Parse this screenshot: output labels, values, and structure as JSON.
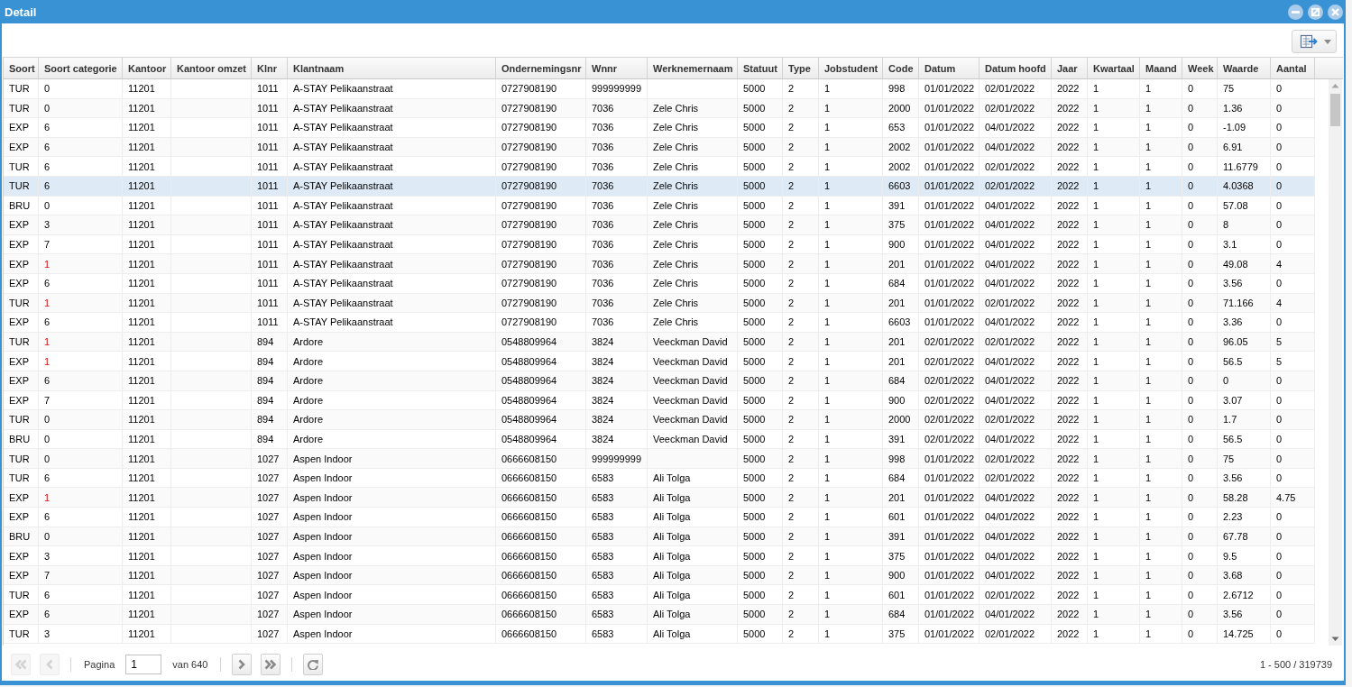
{
  "window": {
    "title": "Detail"
  },
  "table": {
    "columns": [
      "Soort",
      "Soort categorie",
      "Kantoor",
      "Kantoor omzet",
      "Klnr",
      "Klantnaam",
      "Ondernemingsnr",
      "Wnnr",
      "Werknemernaam",
      "Statuut",
      "Type",
      "Jobstudent",
      "Code",
      "Datum",
      "Datum hoofd",
      "Jaar",
      "Kwartaal",
      "Maand",
      "Week",
      "Waarde",
      "Aantal"
    ],
    "rows": [
      {
        "cells": [
          "TUR",
          "0",
          "11201",
          null,
          "1011",
          "A-STAY Pelikaanstraat",
          "0727908190",
          "999999999",
          null,
          "5000",
          "2",
          "1",
          "998",
          "01/01/2022",
          "02/01/2022",
          "2022",
          "1",
          "1",
          "0",
          "75",
          "0"
        ],
        "selected": false,
        "category_flagged": false
      },
      {
        "cells": [
          "TUR",
          "0",
          "11201",
          null,
          "1011",
          "A-STAY Pelikaanstraat",
          "0727908190",
          "7036",
          "Zele Chris",
          "5000",
          "2",
          "1",
          "2000",
          "01/01/2022",
          "02/01/2022",
          "2022",
          "1",
          "1",
          "0",
          "1.36",
          "0"
        ],
        "selected": false,
        "category_flagged": false
      },
      {
        "cells": [
          "EXP",
          "6",
          "11201",
          null,
          "1011",
          "A-STAY Pelikaanstraat",
          "0727908190",
          "7036",
          "Zele Chris",
          "5000",
          "2",
          "1",
          "653",
          "01/01/2022",
          "04/01/2022",
          "2022",
          "1",
          "1",
          "0",
          "-1.09",
          "0"
        ],
        "selected": false,
        "category_flagged": false
      },
      {
        "cells": [
          "EXP",
          "6",
          "11201",
          null,
          "1011",
          "A-STAY Pelikaanstraat",
          "0727908190",
          "7036",
          "Zele Chris",
          "5000",
          "2",
          "1",
          "2002",
          "01/01/2022",
          "04/01/2022",
          "2022",
          "1",
          "1",
          "0",
          "6.91",
          "0"
        ],
        "selected": false,
        "category_flagged": false
      },
      {
        "cells": [
          "TUR",
          "6",
          "11201",
          null,
          "1011",
          "A-STAY Pelikaanstraat",
          "0727908190",
          "7036",
          "Zele Chris",
          "5000",
          "2",
          "1",
          "2002",
          "01/01/2022",
          "02/01/2022",
          "2022",
          "1",
          "1",
          "0",
          "11.6779",
          "0"
        ],
        "selected": false,
        "category_flagged": false
      },
      {
        "cells": [
          "TUR",
          "6",
          "11201",
          null,
          "1011",
          "A-STAY Pelikaanstraat",
          "0727908190",
          "7036",
          "Zele Chris",
          "5000",
          "2",
          "1",
          "6603",
          "01/01/2022",
          "02/01/2022",
          "2022",
          "1",
          "1",
          "0",
          "4.0368",
          "0"
        ],
        "selected": true,
        "category_flagged": false
      },
      {
        "cells": [
          "BRU",
          "0",
          "11201",
          null,
          "1011",
          "A-STAY Pelikaanstraat",
          "0727908190",
          "7036",
          "Zele Chris",
          "5000",
          "2",
          "1",
          "391",
          "01/01/2022",
          "04/01/2022",
          "2022",
          "1",
          "1",
          "0",
          "57.08",
          "0"
        ],
        "selected": false,
        "category_flagged": false
      },
      {
        "cells": [
          "EXP",
          "3",
          "11201",
          null,
          "1011",
          "A-STAY Pelikaanstraat",
          "0727908190",
          "7036",
          "Zele Chris",
          "5000",
          "2",
          "1",
          "375",
          "01/01/2022",
          "04/01/2022",
          "2022",
          "1",
          "1",
          "0",
          "8",
          "0"
        ],
        "selected": false,
        "category_flagged": false
      },
      {
        "cells": [
          "EXP",
          "7",
          "11201",
          null,
          "1011",
          "A-STAY Pelikaanstraat",
          "0727908190",
          "7036",
          "Zele Chris",
          "5000",
          "2",
          "1",
          "900",
          "01/01/2022",
          "04/01/2022",
          "2022",
          "1",
          "1",
          "0",
          "3.1",
          "0"
        ],
        "selected": false,
        "category_flagged": false
      },
      {
        "cells": [
          "EXP",
          "1",
          "11201",
          null,
          "1011",
          "A-STAY Pelikaanstraat",
          "0727908190",
          "7036",
          "Zele Chris",
          "5000",
          "2",
          "1",
          "201",
          "01/01/2022",
          "04/01/2022",
          "2022",
          "1",
          "1",
          "0",
          "49.08",
          "4"
        ],
        "selected": false,
        "category_flagged": true
      },
      {
        "cells": [
          "EXP",
          "6",
          "11201",
          null,
          "1011",
          "A-STAY Pelikaanstraat",
          "0727908190",
          "7036",
          "Zele Chris",
          "5000",
          "2",
          "1",
          "684",
          "01/01/2022",
          "04/01/2022",
          "2022",
          "1",
          "1",
          "0",
          "3.56",
          "0"
        ],
        "selected": false,
        "category_flagged": false
      },
      {
        "cells": [
          "TUR",
          "1",
          "11201",
          null,
          "1011",
          "A-STAY Pelikaanstraat",
          "0727908190",
          "7036",
          "Zele Chris",
          "5000",
          "2",
          "1",
          "201",
          "01/01/2022",
          "02/01/2022",
          "2022",
          "1",
          "1",
          "0",
          "71.166",
          "4"
        ],
        "selected": false,
        "category_flagged": true
      },
      {
        "cells": [
          "EXP",
          "6",
          "11201",
          null,
          "1011",
          "A-STAY Pelikaanstraat",
          "0727908190",
          "7036",
          "Zele Chris",
          "5000",
          "2",
          "1",
          "6603",
          "01/01/2022",
          "04/01/2022",
          "2022",
          "1",
          "1",
          "0",
          "3.36",
          "0"
        ],
        "selected": false,
        "category_flagged": false
      },
      {
        "cells": [
          "TUR",
          "1",
          "11201",
          null,
          "894",
          "Ardore",
          "0548809964",
          "3824",
          "Veeckman David",
          "5000",
          "2",
          "1",
          "201",
          "02/01/2022",
          "02/01/2022",
          "2022",
          "1",
          "1",
          "0",
          "96.05",
          "5"
        ],
        "selected": false,
        "category_flagged": true
      },
      {
        "cells": [
          "EXP",
          "1",
          "11201",
          null,
          "894",
          "Ardore",
          "0548809964",
          "3824",
          "Veeckman David",
          "5000",
          "2",
          "1",
          "201",
          "02/01/2022",
          "04/01/2022",
          "2022",
          "1",
          "1",
          "0",
          "56.5",
          "5"
        ],
        "selected": false,
        "category_flagged": true
      },
      {
        "cells": [
          "EXP",
          "6",
          "11201",
          null,
          "894",
          "Ardore",
          "0548809964",
          "3824",
          "Veeckman David",
          "5000",
          "2",
          "1",
          "684",
          "02/01/2022",
          "04/01/2022",
          "2022",
          "1",
          "1",
          "0",
          "0",
          "0"
        ],
        "selected": false,
        "category_flagged": false
      },
      {
        "cells": [
          "EXP",
          "7",
          "11201",
          null,
          "894",
          "Ardore",
          "0548809964",
          "3824",
          "Veeckman David",
          "5000",
          "2",
          "1",
          "900",
          "02/01/2022",
          "04/01/2022",
          "2022",
          "1",
          "1",
          "0",
          "3.07",
          "0"
        ],
        "selected": false,
        "category_flagged": false
      },
      {
        "cells": [
          "TUR",
          "0",
          "11201",
          null,
          "894",
          "Ardore",
          "0548809964",
          "3824",
          "Veeckman David",
          "5000",
          "2",
          "1",
          "2000",
          "02/01/2022",
          "02/01/2022",
          "2022",
          "1",
          "1",
          "0",
          "1.7",
          "0"
        ],
        "selected": false,
        "category_flagged": false
      },
      {
        "cells": [
          "BRU",
          "0",
          "11201",
          null,
          "894",
          "Ardore",
          "0548809964",
          "3824",
          "Veeckman David",
          "5000",
          "2",
          "1",
          "391",
          "02/01/2022",
          "04/01/2022",
          "2022",
          "1",
          "1",
          "0",
          "56.5",
          "0"
        ],
        "selected": false,
        "category_flagged": false
      },
      {
        "cells": [
          "TUR",
          "0",
          "11201",
          null,
          "1027",
          "Aspen Indoor",
          "0666608150",
          "999999999",
          null,
          "5000",
          "2",
          "1",
          "998",
          "01/01/2022",
          "02/01/2022",
          "2022",
          "1",
          "1",
          "0",
          "75",
          "0"
        ],
        "selected": false,
        "category_flagged": false
      },
      {
        "cells": [
          "TUR",
          "6",
          "11201",
          null,
          "1027",
          "Aspen Indoor",
          "0666608150",
          "6583",
          "Ali Tolga",
          "5000",
          "2",
          "1",
          "684",
          "01/01/2022",
          "02/01/2022",
          "2022",
          "1",
          "1",
          "0",
          "3.56",
          "0"
        ],
        "selected": false,
        "category_flagged": false
      },
      {
        "cells": [
          "EXP",
          "1",
          "11201",
          null,
          "1027",
          "Aspen Indoor",
          "0666608150",
          "6583",
          "Ali Tolga",
          "5000",
          "2",
          "1",
          "201",
          "01/01/2022",
          "04/01/2022",
          "2022",
          "1",
          "1",
          "0",
          "58.28",
          "4.75"
        ],
        "selected": false,
        "category_flagged": true
      },
      {
        "cells": [
          "EXP",
          "6",
          "11201",
          null,
          "1027",
          "Aspen Indoor",
          "0666608150",
          "6583",
          "Ali Tolga",
          "5000",
          "2",
          "1",
          "601",
          "01/01/2022",
          "04/01/2022",
          "2022",
          "1",
          "1",
          "0",
          "2.23",
          "0"
        ],
        "selected": false,
        "category_flagged": false
      },
      {
        "cells": [
          "BRU",
          "0",
          "11201",
          null,
          "1027",
          "Aspen Indoor",
          "0666608150",
          "6583",
          "Ali Tolga",
          "5000",
          "2",
          "1",
          "391",
          "01/01/2022",
          "04/01/2022",
          "2022",
          "1",
          "1",
          "0",
          "67.78",
          "0"
        ],
        "selected": false,
        "category_flagged": false
      },
      {
        "cells": [
          "EXP",
          "3",
          "11201",
          null,
          "1027",
          "Aspen Indoor",
          "0666608150",
          "6583",
          "Ali Tolga",
          "5000",
          "2",
          "1",
          "375",
          "01/01/2022",
          "04/01/2022",
          "2022",
          "1",
          "1",
          "0",
          "9.5",
          "0"
        ],
        "selected": false,
        "category_flagged": false
      },
      {
        "cells": [
          "EXP",
          "7",
          "11201",
          null,
          "1027",
          "Aspen Indoor",
          "0666608150",
          "6583",
          "Ali Tolga",
          "5000",
          "2",
          "1",
          "900",
          "01/01/2022",
          "04/01/2022",
          "2022",
          "1",
          "1",
          "0",
          "3.68",
          "0"
        ],
        "selected": false,
        "category_flagged": false
      },
      {
        "cells": [
          "TUR",
          "6",
          "11201",
          null,
          "1027",
          "Aspen Indoor",
          "0666608150",
          "6583",
          "Ali Tolga",
          "5000",
          "2",
          "1",
          "601",
          "01/01/2022",
          "02/01/2022",
          "2022",
          "1",
          "1",
          "0",
          "2.6712",
          "0"
        ],
        "selected": false,
        "category_flagged": false
      },
      {
        "cells": [
          "EXP",
          "6",
          "11201",
          null,
          "1027",
          "Aspen Indoor",
          "0666608150",
          "6583",
          "Ali Tolga",
          "5000",
          "2",
          "1",
          "684",
          "01/01/2022",
          "04/01/2022",
          "2022",
          "1",
          "1",
          "0",
          "3.56",
          "0"
        ],
        "selected": false,
        "category_flagged": false
      },
      {
        "cells": [
          "TUR",
          "3",
          "11201",
          null,
          "1027",
          "Aspen Indoor",
          "0666608150",
          "6583",
          "Ali Tolga",
          "5000",
          "2",
          "1",
          "375",
          "01/01/2022",
          "02/01/2022",
          "2022",
          "1",
          "1",
          "0",
          "14.725",
          "0"
        ],
        "selected": false,
        "category_flagged": false
      }
    ]
  },
  "pager": {
    "items": [
      {
        "kind": "first",
        "disabled": true
      },
      {
        "kind": "prev",
        "disabled": true
      },
      {
        "kind": "separator"
      },
      {
        "kind": "text",
        "text": "Pagina"
      },
      {
        "kind": "input",
        "value": "1"
      },
      {
        "kind": "text",
        "text": "van 640"
      },
      {
        "kind": "separator"
      },
      {
        "kind": "next",
        "disabled": false
      },
      {
        "kind": "last",
        "disabled": false
      },
      {
        "kind": "separator"
      },
      {
        "kind": "refresh",
        "disabled": false
      }
    ],
    "display_info": "1 - 500 / 319739"
  }
}
